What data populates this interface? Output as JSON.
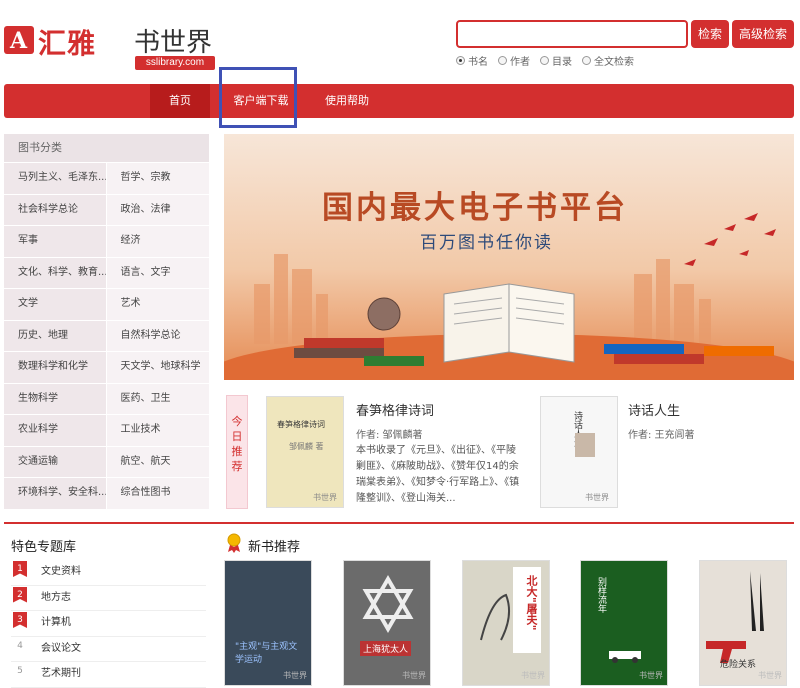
{
  "logo": {
    "mark": "A",
    "brand": "汇雅",
    "name": "书世界",
    "url": "sslibrary.com"
  },
  "search": {
    "value": "",
    "search_btn": "检索",
    "advanced_btn": "高级检索",
    "options": [
      "书名",
      "作者",
      "目录",
      "全文检索"
    ],
    "selected": "书名"
  },
  "nav": {
    "home": "首页",
    "client": "客户端下载",
    "help": "使用帮助"
  },
  "category": {
    "title": "图书分类",
    "rows": [
      [
        "马列主义、毛泽东...",
        "哲学、宗教"
      ],
      [
        "社会科学总论",
        "政治、法律"
      ],
      [
        "军事",
        "经济"
      ],
      [
        "文化、科学、教育...",
        "语言、文字"
      ],
      [
        "文学",
        "艺术"
      ],
      [
        "历史、地理",
        "自然科学总论"
      ],
      [
        "数理科学和化学",
        "天文学、地球科学"
      ],
      [
        "生物科学",
        "医药、卫生"
      ],
      [
        "农业科学",
        "工业技术"
      ],
      [
        "交通运输",
        "航空、航天"
      ],
      [
        "环境科学、安全科...",
        "综合性图书"
      ]
    ]
  },
  "banner": {
    "title": "国内最大电子书平台",
    "subtitle": "百万图书任你读"
  },
  "today": {
    "tag": "今日推荐",
    "book1": {
      "cover_title": "春笋格律诗词",
      "cover_author": "邹佩麟 著",
      "title": "春笋格律诗词",
      "author": "作者: 邹佩麟著",
      "desc": "本书收录了《元旦》、《出征》、《平陵剿匪》、《麻陂助战》、《赞年仅14的余瑞棠表弟》、《知梦令·行军路上》、《镇隆整训》、《登山海关..."
    },
    "book2": {
      "cover_title": "诗话人生",
      "title": "诗话人生",
      "author": "作者: 王充闾著"
    },
    "watermark": "书世界"
  },
  "special": {
    "title": "特色专题库",
    "items": [
      {
        "num": "1",
        "label": "文史资料"
      },
      {
        "num": "2",
        "label": "地方志"
      },
      {
        "num": "3",
        "label": "计算机"
      },
      {
        "num": "4",
        "label": "会议论文"
      },
      {
        "num": "5",
        "label": "艺术期刊"
      }
    ]
  },
  "new_books": {
    "title": "新书推荐",
    "books": [
      {
        "text": "\"主观\"与主观文学运动",
        "mark": "书世界"
      },
      {
        "text": "上海犹太人",
        "mark": "书世界"
      },
      {
        "text": "",
        "mark": "书世界"
      },
      {
        "text": "北大\"屠夫\"",
        "mark": "书世界"
      },
      {
        "text": "别样流年",
        "mark": "书世界"
      },
      {
        "text": "危险关系",
        "mark": "书世界"
      }
    ]
  },
  "colors": {
    "brand_red": "#d32f2f",
    "highlight_blue": "#3f51b5"
  }
}
